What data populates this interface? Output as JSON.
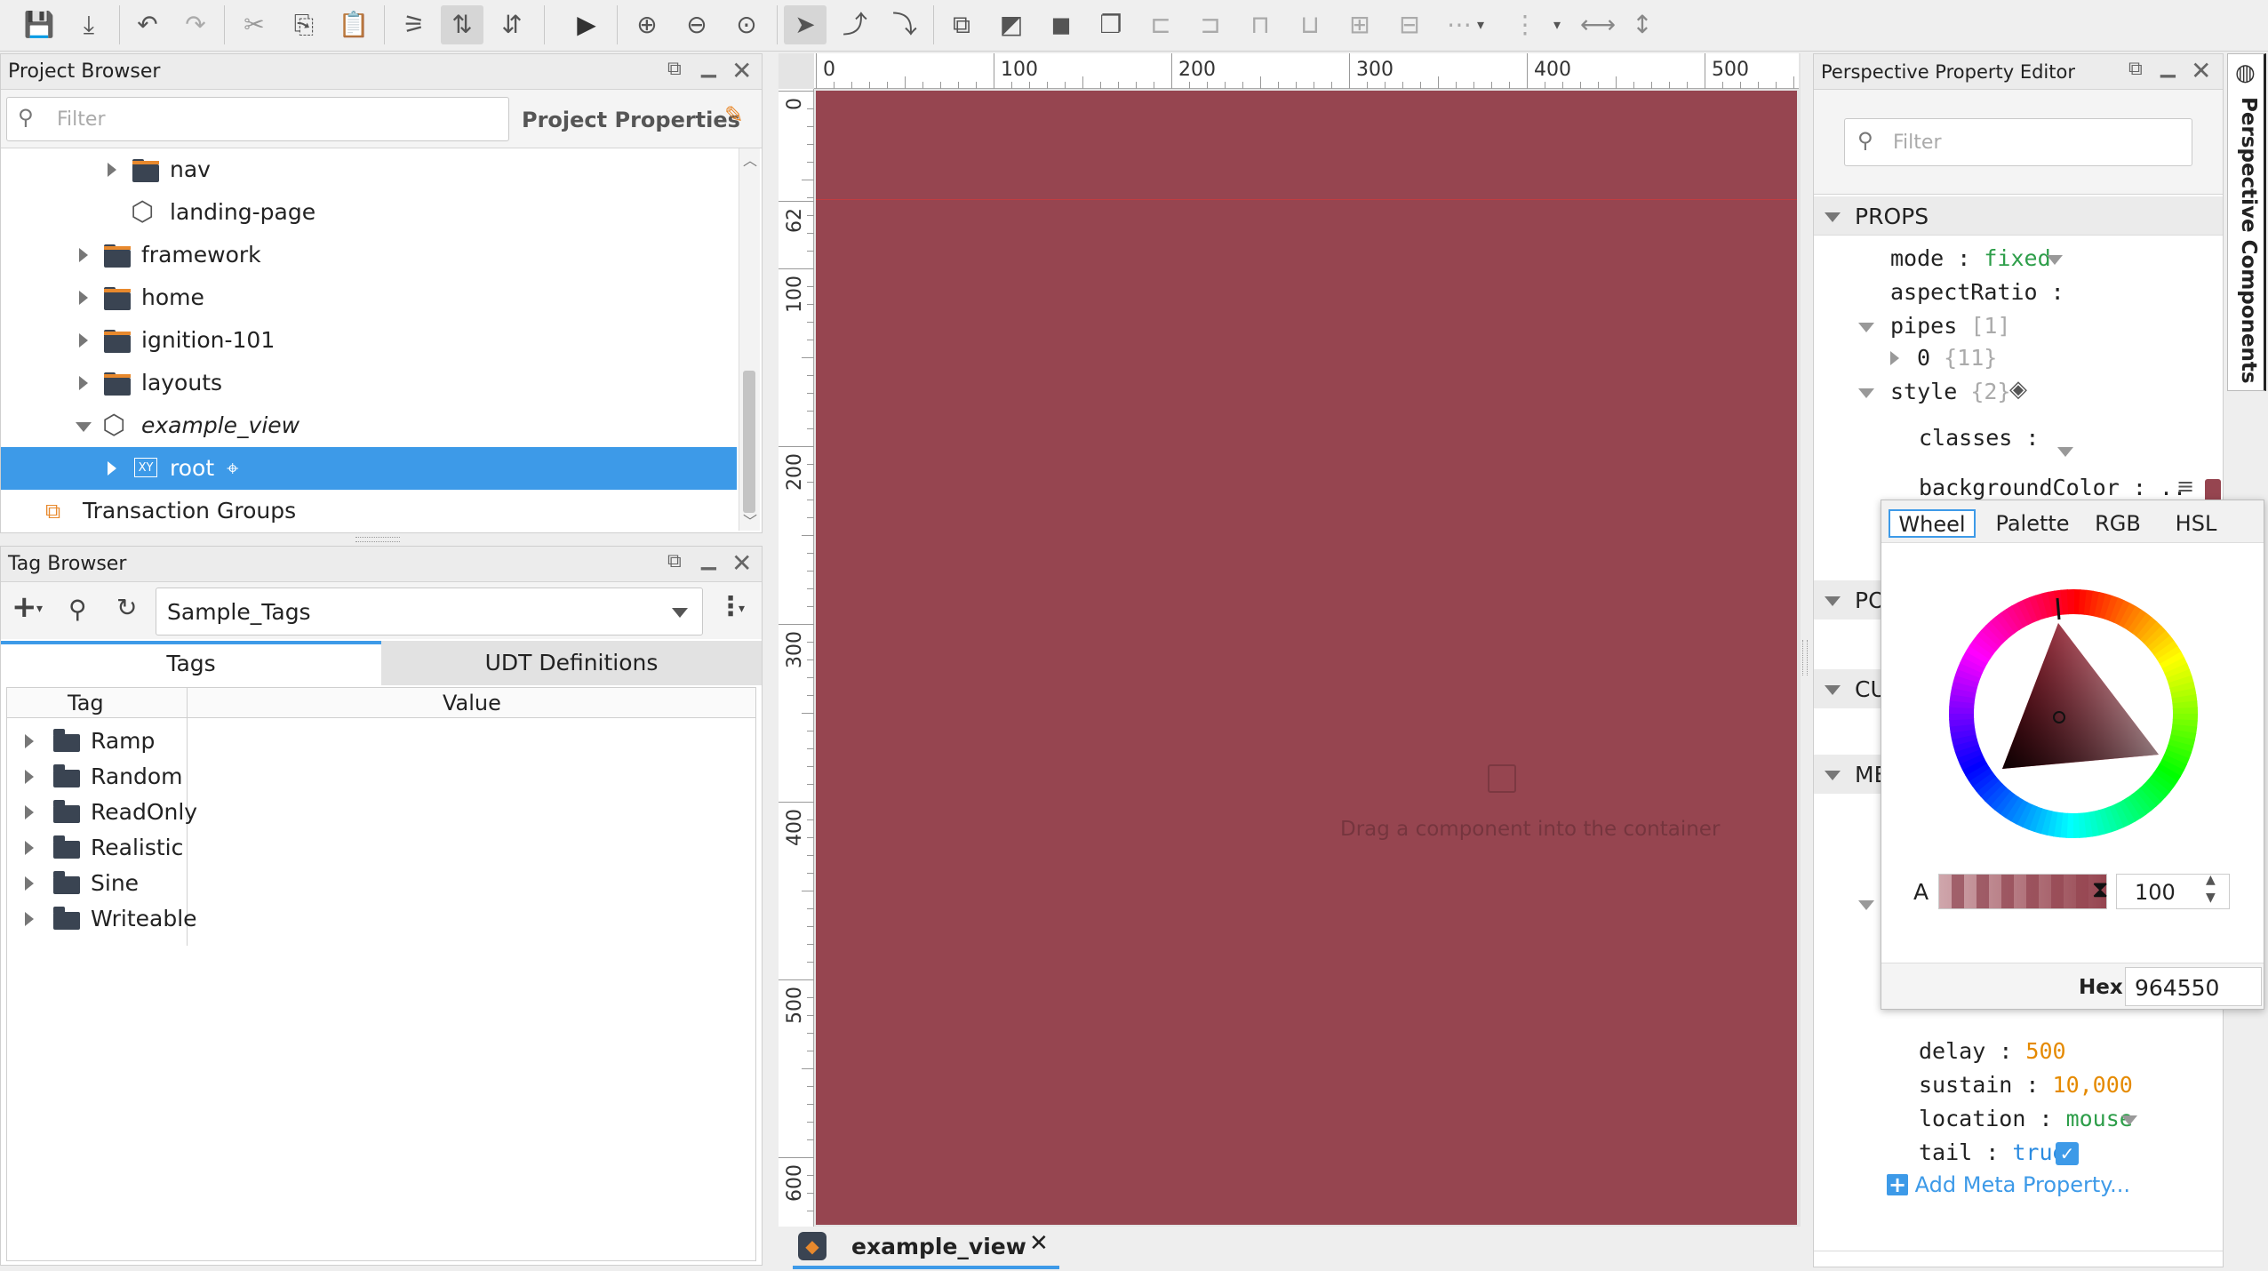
{
  "toolbar": {
    "left_icons": [
      "save-icon",
      "save-all-icon",
      "undo-icon",
      "redo-icon",
      "cut-icon",
      "copy-icon",
      "paste-icon",
      "snap-icon",
      "align-icon",
      "distribute-icon",
      "play-icon",
      "zoom-in-icon",
      "zoom-out-icon",
      "zoom-fit-icon"
    ],
    "right_icons": [
      "select-icon",
      "connect-icon",
      "reshape-icon",
      "bring-front-icon",
      "send-back-icon",
      "group-icon",
      "ungroup-icon",
      "align-left-icon",
      "align-right-icon",
      "align-top-icon",
      "align-bottom-icon",
      "align-center-icon",
      "align-middle-icon",
      "distribute-h-icon",
      "distribute-v-icon",
      "equal-width-icon",
      "equal-height-icon"
    ]
  },
  "project_browser": {
    "title": "Project Browser",
    "filter_placeholder": "Filter",
    "project_properties": "Project Properties",
    "tree": [
      {
        "label": "nav",
        "type": "folder"
      },
      {
        "label": "landing-page",
        "type": "view"
      },
      {
        "label": "framework",
        "type": "folder"
      },
      {
        "label": "home",
        "type": "folder"
      },
      {
        "label": "ignition-101",
        "type": "folder"
      },
      {
        "label": "layouts",
        "type": "folder"
      },
      {
        "label": "example_view",
        "type": "view"
      },
      {
        "label": "root",
        "type": "container",
        "badge": "XY"
      },
      {
        "label": "Transaction Groups",
        "type": "transaction"
      }
    ]
  },
  "tag_browser": {
    "title": "Tag Browser",
    "provider": "Sample_Tags",
    "tabs": [
      "Tags",
      "UDT Definitions"
    ],
    "columns": [
      "Tag",
      "Value"
    ],
    "tags": [
      "Ramp",
      "Random",
      "ReadOnly",
      "Realistic",
      "Sine",
      "Writeable"
    ]
  },
  "canvas": {
    "background": "#964550",
    "ruler_top": [
      "0",
      "100",
      "200",
      "300",
      "400",
      "500"
    ],
    "ruler_left": [
      "0",
      "62",
      "100",
      "200",
      "300",
      "400",
      "500",
      "600"
    ],
    "hint": "Drag a component into the container",
    "tab": "example_view"
  },
  "property_editor": {
    "title": "Perspective Property Editor",
    "filter_placeholder": "Filter",
    "sections": {
      "props": "PROPS",
      "position": "PO",
      "custom": "CU",
      "meta": "ME"
    },
    "props": {
      "mode_key": "mode",
      "mode_val": "fixed",
      "aspect_key": "aspectRatio",
      "pipes_key": "pipes",
      "pipes_count": "[1]",
      "pipe0_key": "0",
      "pipe0_count": "{11}",
      "style_key": "style",
      "style_count": "{2}",
      "classes_key": "classes",
      "bg_key": "backgroundColor",
      "bg_val": ".."
    },
    "meta": {
      "delay_key": "delay",
      "delay_val": "500",
      "sustain_key": "sustain",
      "sustain_val": "10,000",
      "location_key": "location",
      "location_val": "mouse",
      "tail_key": "tail",
      "tail_val": "true",
      "add_label": "Add Meta Property..."
    },
    "side_tab": "Perspective Components"
  },
  "color_picker": {
    "tabs": [
      "Wheel",
      "Palette",
      "RGB",
      "HSL"
    ],
    "alpha_label": "A",
    "alpha_value": "100",
    "hex_label": "Hex",
    "hex_value": "964550"
  }
}
